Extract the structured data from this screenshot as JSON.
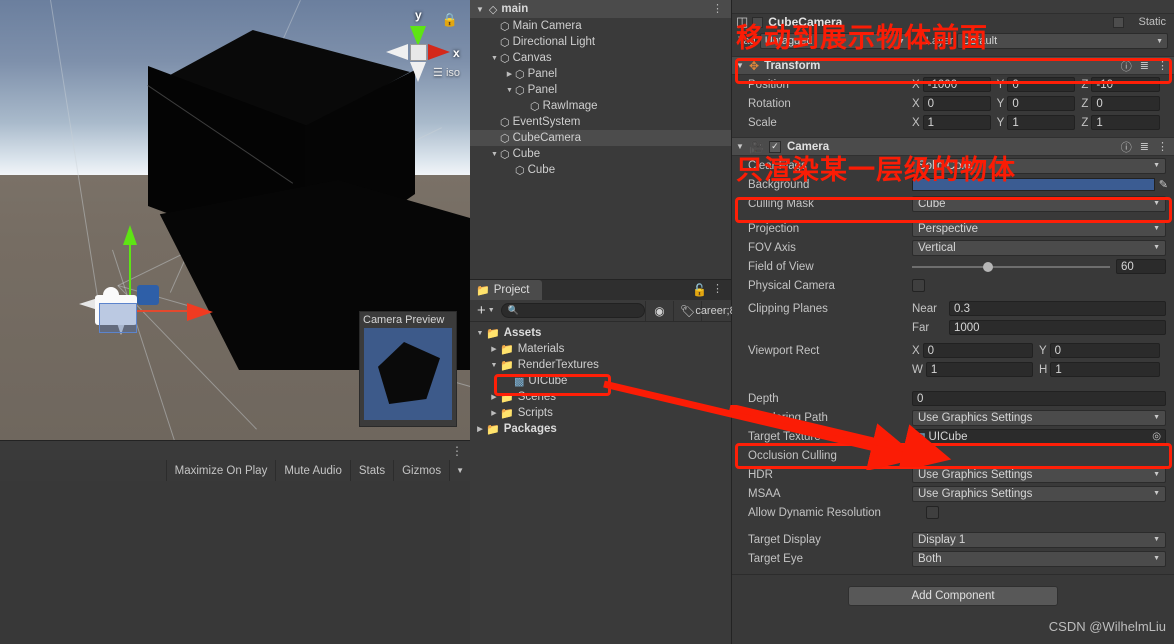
{
  "scene_view": {
    "orientation_gizmo": {
      "y_label": "y",
      "x_label": "x",
      "view_mode": "iso",
      "lock_icon": "lock-icon"
    },
    "camera_preview": {
      "title": "Camera Preview",
      "background_color": "#3d5a8a"
    },
    "play_toolbar": {
      "buttons": [
        "Maximize On Play",
        "Mute Audio",
        "Stats",
        "Gizmos"
      ],
      "gizmos_caret": "▼"
    },
    "sky_color": "#7e90ab",
    "ground_color": "#766d63"
  },
  "hierarchy": {
    "scene_name": "main",
    "menu_icon": "kebab-menu-icon",
    "items": [
      {
        "label": "Main Camera",
        "depth": 1,
        "twisty": "",
        "selected": false
      },
      {
        "label": "Directional Light",
        "depth": 1,
        "twisty": "",
        "selected": false
      },
      {
        "label": "Canvas",
        "depth": 1,
        "twisty": "▼",
        "selected": false
      },
      {
        "label": "Panel",
        "depth": 2,
        "twisty": "▶",
        "selected": false
      },
      {
        "label": "Panel",
        "depth": 2,
        "twisty": "▼",
        "selected": false
      },
      {
        "label": "RawImage",
        "depth": 3,
        "twisty": "",
        "selected": false
      },
      {
        "label": "EventSystem",
        "depth": 1,
        "twisty": "",
        "selected": false
      },
      {
        "label": "CubeCamera",
        "depth": 1,
        "twisty": "",
        "selected": true
      },
      {
        "label": "Cube",
        "depth": 1,
        "twisty": "▼",
        "selected": false
      },
      {
        "label": "Cube",
        "depth": 2,
        "twisty": "",
        "selected": false
      }
    ]
  },
  "project": {
    "tab_label": "Project",
    "lock_icon": "lock-icon",
    "menu_icon": "kebab-menu-icon",
    "create_label": "+",
    "search_placeholder": "",
    "search_icon": "search-icon",
    "toolbar_icons": [
      "asset-filter-icon",
      "label-filter-icon",
      "hidden-packages-icon"
    ],
    "hidden_count": "8",
    "tree": [
      {
        "label": "Assets",
        "depth": 0,
        "twisty": "▼",
        "icon": "folder-open-icon",
        "bold": true,
        "highlighted": false
      },
      {
        "label": "Materials",
        "depth": 1,
        "twisty": "▶",
        "icon": "folder-icon",
        "bold": false,
        "highlighted": false
      },
      {
        "label": "RenderTextures",
        "depth": 1,
        "twisty": "▼",
        "icon": "folder-open-icon",
        "bold": false,
        "highlighted": false
      },
      {
        "label": "UICube",
        "depth": 2,
        "twisty": "",
        "icon": "render-texture-icon",
        "bold": false,
        "highlighted": true
      },
      {
        "label": "Scenes",
        "depth": 1,
        "twisty": "▶",
        "icon": "folder-icon",
        "bold": false,
        "highlighted": false
      },
      {
        "label": "Scripts",
        "depth": 1,
        "twisty": "▶",
        "icon": "folder-icon",
        "bold": false,
        "highlighted": false
      },
      {
        "label": "Packages",
        "depth": 0,
        "twisty": "▶",
        "icon": "folder-icon",
        "bold": true,
        "highlighted": false
      }
    ]
  },
  "inspector": {
    "object_name": "CubeCamera",
    "object_enabled": true,
    "static_label": "Static",
    "tag_label": "Tag",
    "tag_value": "Untagged",
    "layer_label": "Layer",
    "layer_value": "Default",
    "transform": {
      "title": "Transform",
      "icon": "transform-icon",
      "help_icon": "help-icon",
      "preset_icon": "preset-icon",
      "menu_icon": "kebab-menu-icon",
      "rows": [
        {
          "label": "Position",
          "x": "-1000",
          "y": "0",
          "z": "-10"
        },
        {
          "label": "Rotation",
          "x": "0",
          "y": "0",
          "z": "0"
        },
        {
          "label": "Scale",
          "x": "1",
          "y": "1",
          "z": "1"
        }
      ]
    },
    "camera": {
      "title": "Camera",
      "icon": "camera-icon",
      "enabled": true,
      "help_icon": "help-icon",
      "preset_icon": "preset-icon",
      "menu_icon": "kebab-menu-icon",
      "clear_flags_label": "Clear Flags",
      "clear_flags_value": "Solid Color",
      "background_label": "Background",
      "background_color": "#3b5c92",
      "eyedropper_icon": "eyedropper-icon",
      "culling_mask_label": "Culling Mask",
      "culling_mask_value": "Cube",
      "projection_label": "Projection",
      "projection_value": "Perspective",
      "fov_axis_label": "FOV Axis",
      "fov_axis_value": "Vertical",
      "field_of_view_label": "Field of View",
      "field_of_view_value": "60",
      "field_of_view_pct": 36,
      "physical_camera_label": "Physical Camera",
      "physical_camera_checked": false,
      "clipping_planes_label": "Clipping Planes",
      "clipping_near_label": "Near",
      "clipping_near_value": "0.3",
      "clipping_far_label": "Far",
      "clipping_far_value": "1000",
      "viewport_rect_label": "Viewport Rect",
      "viewport_x_label": "X",
      "viewport_x_value": "0",
      "viewport_y_label": "Y",
      "viewport_y_value": "0",
      "viewport_w_label": "W",
      "viewport_w_value": "1",
      "viewport_h_label": "H",
      "viewport_h_value": "1",
      "depth_label": "Depth",
      "depth_value": "0",
      "rendering_path_label": "Rendering Path",
      "rendering_path_value": "Use Graphics Settings",
      "target_texture_label": "Target Texture",
      "target_texture_value": "UICube",
      "target_texture_icon": "render-texture-icon",
      "target_texture_picker_icon": "object-picker-icon",
      "occlusion_culling_label": "Occlusion Culling",
      "occlusion_culling_checked": true,
      "hdr_label": "HDR",
      "hdr_value": "Use Graphics Settings",
      "msaa_label": "MSAA",
      "msaa_value": "Use Graphics Settings",
      "allow_dynamic_resolution_label": "Allow Dynamic Resolution",
      "allow_dynamic_resolution_checked": false,
      "target_display_label": "Target Display",
      "target_display_value": "Display 1",
      "target_eye_label": "Target Eye",
      "target_eye_value": "Both"
    },
    "add_component_label": "Add Component",
    "watermark": "CSDN @WilhelmLiu"
  },
  "annotations": {
    "accent_color": "#fb1c05",
    "note_1": "移动到展示物体前面",
    "note_2": "只渲染某一层级的物体"
  }
}
